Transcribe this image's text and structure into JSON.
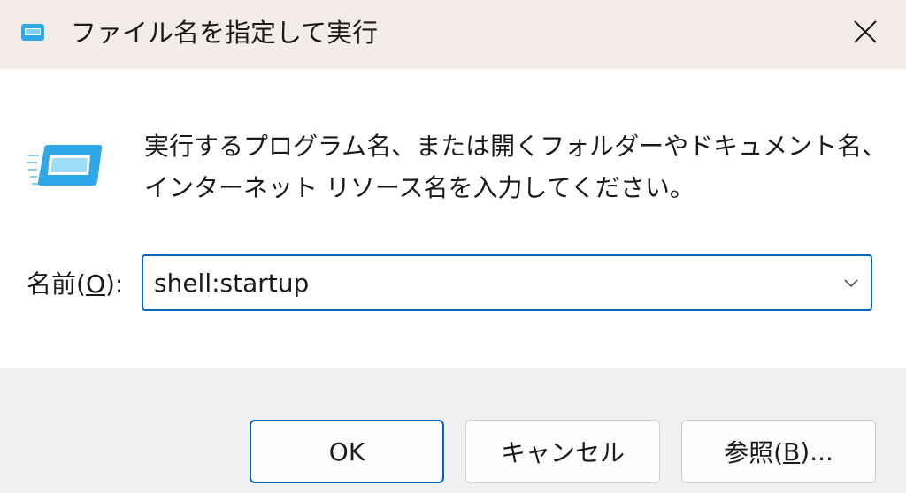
{
  "window": {
    "title": "ファイル名を指定して実行",
    "icon": "run-dialog-icon",
    "close_icon": "close-icon"
  },
  "content": {
    "description": "実行するプログラム名、または開くフォルダーやドキュメント名、インターネット リソース名を入力してください。",
    "name_label_prefix": "名前(",
    "name_label_access_key": "O",
    "name_label_suffix": "):",
    "name_input_value": "shell:startup"
  },
  "buttons": {
    "ok_label": "OK",
    "cancel_label": "キャンセル",
    "browse_label_prefix": "参照(",
    "browse_access_key": "B",
    "browse_label_suffix": ")..."
  },
  "colors": {
    "accent": "#0067c0",
    "titlebar": "#f3ece9",
    "content_bg": "#ffffff",
    "footer_bg": "#f0f0f0",
    "icon_blue": "#2ea8e6"
  }
}
